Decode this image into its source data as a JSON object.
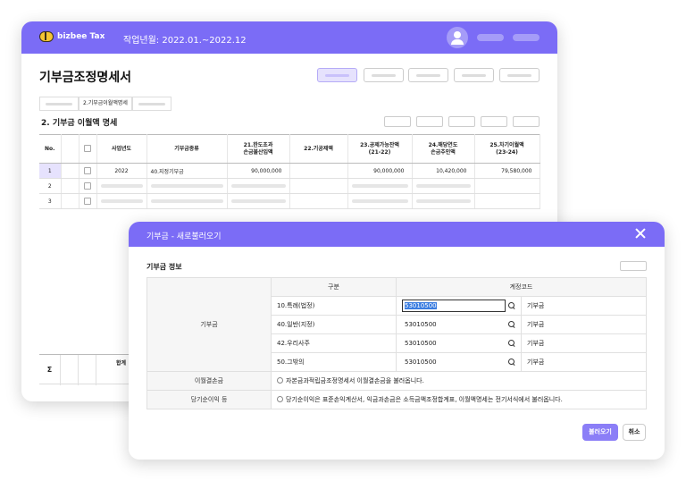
{
  "app": {
    "name": "bizbee Tax",
    "period": "작업년월: 2022.01.~2022.12"
  },
  "page": {
    "title": "기부금조정명세서"
  },
  "tabs": {
    "active": "2.기부금이월액명세"
  },
  "section": {
    "title": "2. 기부금 이월액 명세"
  },
  "grid": {
    "headers": [
      "No.",
      "",
      "",
      "사업년도",
      "기부금종류",
      "21.한도초과\n손금불산입액",
      "22.기공제액",
      "23.공제가능잔액\n(21-22)",
      "24.해당연도\n손금추인액",
      "25.차기이월액\n(23-24)"
    ],
    "rows": [
      {
        "no": "1",
        "year": "2022",
        "type": "40.지정기부금",
        "c21": "90,000,000",
        "c22": "",
        "c23": "90,000,000",
        "c24": "10,420,000",
        "c25": "79,580,000"
      },
      {
        "no": "2"
      },
      {
        "no": "3"
      }
    ],
    "sum_symbol": "Σ",
    "sum_label": "합계"
  },
  "dialog": {
    "title": "기부금 - 새로불러오기",
    "section": "기부금 정보",
    "col_gubun": "구분",
    "col_code": "계정코드",
    "group_label": "기부금",
    "items": [
      {
        "gubun": "10.특례(법정)",
        "code": "53010500",
        "name": "기부금"
      },
      {
        "gubun": "40.일반(지정)",
        "code": "53010500",
        "name": "기부금"
      },
      {
        "gubun": "42.우리사주",
        "code": "53010500",
        "name": "기부금"
      },
      {
        "gubun": "50.그밖의",
        "code": "53010500",
        "name": "기부금"
      }
    ],
    "carry_label": "이월결손금",
    "carry_text": "자본금과적립금조정명세서 이월결손금을 불러옵니다.",
    "income_label": "당기순이익 등",
    "income_text": "당기순이익은 표준손익계산서, 익금과손금은 소득금액조정합계표, 이월액명세는 전기서식에서 불러옵니다.",
    "load_button": "불러오기",
    "cancel_button": "취소"
  }
}
